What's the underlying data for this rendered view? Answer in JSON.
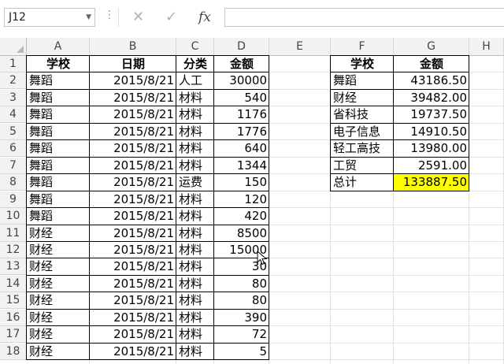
{
  "namebox": "J12",
  "toolbar": {
    "cancel": "✕",
    "enter": "✓",
    "fx": "fx",
    "dots": "⋮"
  },
  "columns": [
    "A",
    "B",
    "C",
    "D",
    "E",
    "F",
    "G",
    "H"
  ],
  "rows": [
    "1",
    "2",
    "3",
    "4",
    "5",
    "6",
    "7",
    "8",
    "9",
    "10",
    "11",
    "12",
    "13",
    "14",
    "15",
    "16",
    "17",
    "18"
  ],
  "table1": {
    "headers": [
      "学校",
      "日期",
      "分类",
      "金额"
    ],
    "rows": [
      [
        "舞蹈",
        "2015/8/21",
        "人工",
        "30000"
      ],
      [
        "舞蹈",
        "2015/8/21",
        "材料",
        "540"
      ],
      [
        "舞蹈",
        "2015/8/21",
        "材料",
        "1176"
      ],
      [
        "舞蹈",
        "2015/8/21",
        "材料",
        "1776"
      ],
      [
        "舞蹈",
        "2015/8/21",
        "材料",
        "640"
      ],
      [
        "舞蹈",
        "2015/8/21",
        "材料",
        "1344"
      ],
      [
        "舞蹈",
        "2015/8/21",
        "运费",
        "150"
      ],
      [
        "舞蹈",
        "2015/8/21",
        "材料",
        "120"
      ],
      [
        "舞蹈",
        "2015/8/21",
        "材料",
        "420"
      ],
      [
        "财经",
        "2015/8/21",
        "材料",
        "8500"
      ],
      [
        "财经",
        "2015/8/21",
        "材料",
        "15000"
      ],
      [
        "财经",
        "2015/8/21",
        "材料",
        "30"
      ],
      [
        "财经",
        "2015/8/21",
        "材料",
        "80"
      ],
      [
        "财经",
        "2015/8/21",
        "材料",
        "80"
      ],
      [
        "财经",
        "2015/8/21",
        "材料",
        "390"
      ],
      [
        "财经",
        "2015/8/21",
        "材料",
        "72"
      ],
      [
        "财经",
        "2015/8/21",
        "材料",
        "5"
      ]
    ]
  },
  "table2": {
    "headers": [
      "学校",
      "金额"
    ],
    "rows": [
      [
        "舞蹈",
        "43186.50"
      ],
      [
        "财经",
        "39482.00"
      ],
      [
        "省科技",
        "19737.50"
      ],
      [
        "电子信息",
        "14910.50"
      ],
      [
        "轻工高技",
        "13980.00"
      ],
      [
        "工贸",
        "2591.00"
      ],
      [
        "总计",
        "133887.50"
      ]
    ],
    "highlight_color": "#ffff00"
  }
}
